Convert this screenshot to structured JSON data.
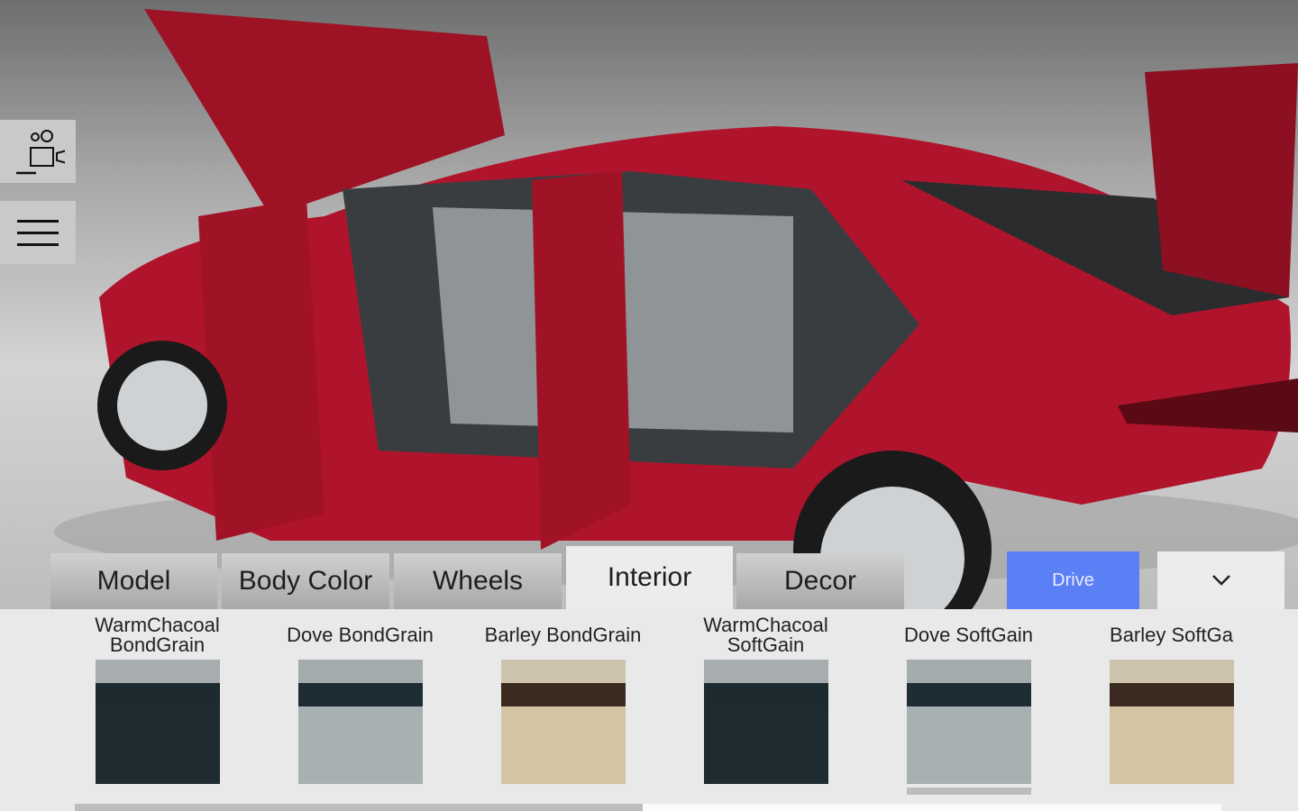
{
  "side": {
    "camera_icon": "video-camera-icon",
    "menu_icon": "hamburger-menu-icon"
  },
  "tabs": [
    {
      "label": "Model"
    },
    {
      "label": "Body Color"
    },
    {
      "label": "Wheels"
    },
    {
      "label": "Interior",
      "active": true
    },
    {
      "label": "Decor"
    }
  ],
  "drive_label": "Drive",
  "more_icon": "chevron-down-icon",
  "colors": {
    "accent": "#5b7ff5",
    "car": "#b0142c"
  },
  "swatches": [
    {
      "name": "WarmChacoal\nBondGrain",
      "top": "#a7adae",
      "band": "#1d2a30",
      "main": "#1e2b31"
    },
    {
      "name": "Dove BondGrain",
      "top": "#a4abac",
      "band": "#1e2c33",
      "main": "#a8b1b2"
    },
    {
      "name": "Barley BondGrain",
      "top": "#cdc3ad",
      "band": "#3a2a20",
      "main": "#d3c5a4"
    },
    {
      "name": "WarmChacoal\nSoftGain",
      "top": "#a7adae",
      "band": "#1d2a30",
      "main": "#1e2b31"
    },
    {
      "name": "Dove SoftGain",
      "top": "#a4abac",
      "band": "#1e2c33",
      "main": "#a8b1b2",
      "selected": true
    },
    {
      "name": "Barley SoftGa",
      "top": "#cdc3ad",
      "band": "#3a2a20",
      "main": "#d3c5a4"
    }
  ],
  "scroll": {
    "position_percent": 0
  }
}
